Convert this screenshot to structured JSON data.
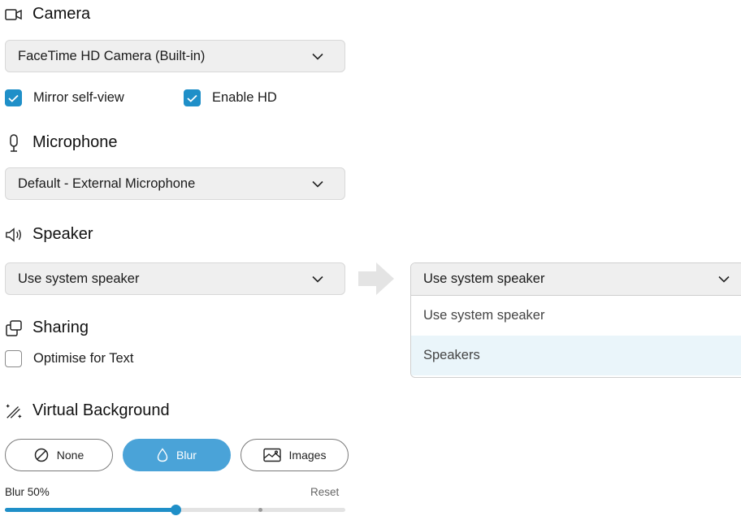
{
  "camera": {
    "title": "Camera",
    "icon": "camera-icon",
    "selected": "FaceTime HD Camera (Built-in)",
    "mirror_label": "Mirror self-view",
    "mirror_checked": true,
    "hd_label": "Enable HD",
    "hd_checked": true
  },
  "microphone": {
    "title": "Microphone",
    "icon": "microphone-icon",
    "selected": "Default - External Microphone"
  },
  "speaker": {
    "title": "Speaker",
    "icon": "speaker-icon",
    "selected": "Use system speaker",
    "open_dropdown": {
      "selected": "Use system speaker",
      "options": [
        "Use system speaker",
        "Speakers"
      ],
      "highlighted_index": 1
    }
  },
  "sharing": {
    "title": "Sharing",
    "icon": "sharing-icon",
    "optimise_label": "Optimise for Text",
    "optimise_checked": false
  },
  "virtual_background": {
    "title": "Virtual Background",
    "icon": "magic-wand-icon",
    "options": [
      {
        "label": "None",
        "icon": "none-icon",
        "active": false
      },
      {
        "label": "Blur",
        "icon": "blur-drop-icon",
        "active": true
      },
      {
        "label": "Images",
        "icon": "image-icon",
        "active": false
      }
    ],
    "blur_label": "Blur 50%",
    "blur_value": 50,
    "reset_label": "Reset"
  },
  "colors": {
    "accent": "#1f8fc8",
    "active_button": "#4aa3d8",
    "dropdown_bg": "#efefef",
    "highlight": "#eaf5fa"
  }
}
